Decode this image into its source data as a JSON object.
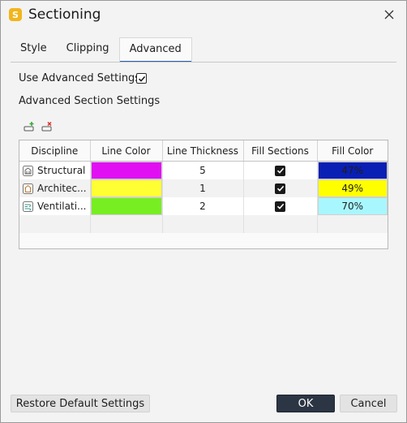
{
  "window": {
    "title": "Sectioning",
    "app_icon_letter": "S"
  },
  "tabs": [
    {
      "label": "Style",
      "active": false
    },
    {
      "label": "Clipping",
      "active": false
    },
    {
      "label": "Advanced",
      "active": true
    }
  ],
  "advanced": {
    "use_advanced_label": "Use Advanced Settings",
    "use_advanced_checked": true,
    "section_settings_label": "Advanced Section Settings",
    "toolbar": {
      "add_icon": "add-row-icon",
      "remove_icon": "remove-row-icon"
    }
  },
  "table": {
    "headers": {
      "discipline": "Discipline",
      "line_color": "Line Color",
      "line_thickness": "Line Thickness",
      "fill_sections": "Fill Sections",
      "fill_color": "Fill Color"
    },
    "rows": [
      {
        "icon": "structural-icon",
        "discipline": "Structural",
        "line_color": "#e010f2",
        "line_thickness": "5",
        "fill_sections": true,
        "fill_color": "#0a1fb4",
        "fill_percent": "47%"
      },
      {
        "icon": "architecture-icon",
        "discipline": "Architec...",
        "line_color": "#ffff33",
        "line_thickness": "1",
        "fill_sections": true,
        "fill_color": "#ffff00",
        "fill_percent": "49%"
      },
      {
        "icon": "ventilation-icon",
        "discipline": "Ventilati...",
        "line_color": "#77ee22",
        "line_thickness": "2",
        "fill_sections": true,
        "fill_color": "#a8f7ff",
        "fill_percent": "70%"
      }
    ]
  },
  "footer": {
    "restore_label": "Restore Default Settings",
    "ok_label": "OK",
    "cancel_label": "Cancel"
  },
  "colors": {
    "accent": "#2c5fb3",
    "primary_button": "#2c3544"
  }
}
